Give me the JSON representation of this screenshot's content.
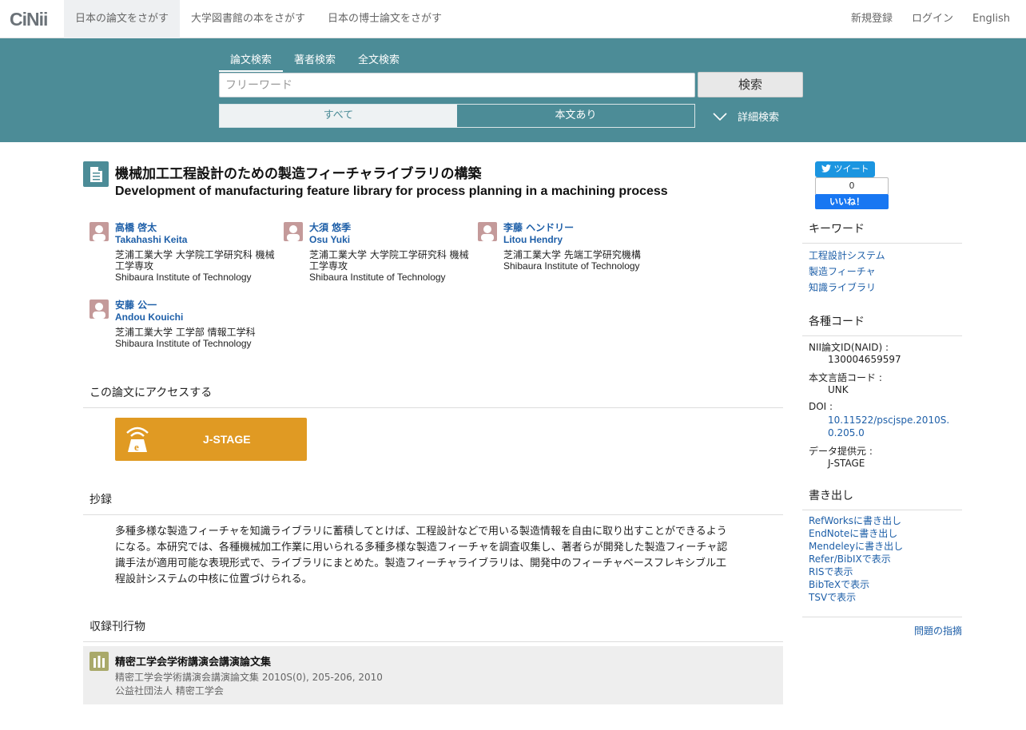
{
  "header": {
    "logo": "CiNii",
    "nav": [
      "日本の論文をさがす",
      "大学図書館の本をさがす",
      "日本の博士論文をさがす"
    ],
    "links": [
      "新規登録",
      "ログイン",
      "English"
    ]
  },
  "search": {
    "tabs": [
      "論文検索",
      "著者検索",
      "全文検索"
    ],
    "placeholder": "フリーワード",
    "button": "検索",
    "filter_all": "すべて",
    "filter_fulltext": "本文あり",
    "advanced": "詳細検索"
  },
  "article": {
    "title_ja": "機械加工工程設計のための製造フィーチャライブラリの構築",
    "title_en": "Development of manufacturing feature library for process planning in a machining process"
  },
  "authors": [
    {
      "name_ja": "高橋 啓太",
      "name_en": "Takahashi Keita",
      "aff_ja": "芝浦工業大学 大学院工学研究科 機械工学専攻",
      "aff_en": "Shibaura Institute of Technology"
    },
    {
      "name_ja": "大須 悠季",
      "name_en": "Osu Yuki",
      "aff_ja": "芝浦工業大学 大学院工学研究科 機械工学専攻",
      "aff_en": "Shibaura Institute of Technology"
    },
    {
      "name_ja": "李藤 ヘンドリー",
      "name_en": "Litou Hendry",
      "aff_ja": "芝浦工業大学 先端工学研究機構",
      "aff_en": "Shibaura Institute of Technology"
    },
    {
      "name_ja": "安藤 公一",
      "name_en": "Andou Kouichi",
      "aff_ja": "芝浦工業大学 工学部 情報工学科",
      "aff_en": "Shibaura Institute of Technology"
    }
  ],
  "access": {
    "heading": "この論文にアクセスする",
    "button": "J-STAGE"
  },
  "abstract": {
    "heading": "抄録",
    "text": "多種多様な製造フィーチャを知識ライブラリに蓄積してとけば、工程設計などで用いる製造情報を自由に取り出すことができるようになる。本研究では、各種機械加工作業に用いられる多種多様な製造フィーチャを調査収集し、著者らが開発した製造フィーチャ認識手法が適用可能な表現形式で、ライブラリにまとめた。製造フィーチャライブラリは、開発中のフィーチャベースフレキシブル工程設計システムの中核に位置づけられる。"
  },
  "journal": {
    "heading": "収録刊行物",
    "title": "精密工学会学術講演会講演論文集",
    "volume": "精密工学会学術講演会講演論文集 2010S(0), 205-206, 2010",
    "publisher": "公益社団法人 精密工学会"
  },
  "social": {
    "tweet": "ツイート",
    "like_count": "0",
    "like": "いいね！"
  },
  "sidebar": {
    "keywords_heading": "キーワード",
    "keywords": [
      "工程設計システム",
      "製造フィーチャ",
      "知識ライブラリ"
    ],
    "codes_heading": "各種コード",
    "naid_label": "NII論文ID(NAID) :",
    "naid": "130004659597",
    "lang_label": "本文言語コード :",
    "lang": "UNK",
    "doi_label": "DOI :",
    "doi": "10.11522/pscjspe.2010S.0.205.0",
    "provider_label": "データ提供元 :",
    "provider": "J-STAGE",
    "export_heading": "書き出し",
    "exports": [
      "RefWorksに書き出し",
      "EndNoteに書き出し",
      "Mendeleyに書き出し",
      "Refer/BibIXで表示",
      "RISで表示",
      "BibTeXで表示",
      "TSVで表示"
    ],
    "report": "問題の指摘"
  },
  "colors": {
    "band": "#4c8c97",
    "link": "#1e5fa8",
    "jstage": "#e09a23"
  }
}
